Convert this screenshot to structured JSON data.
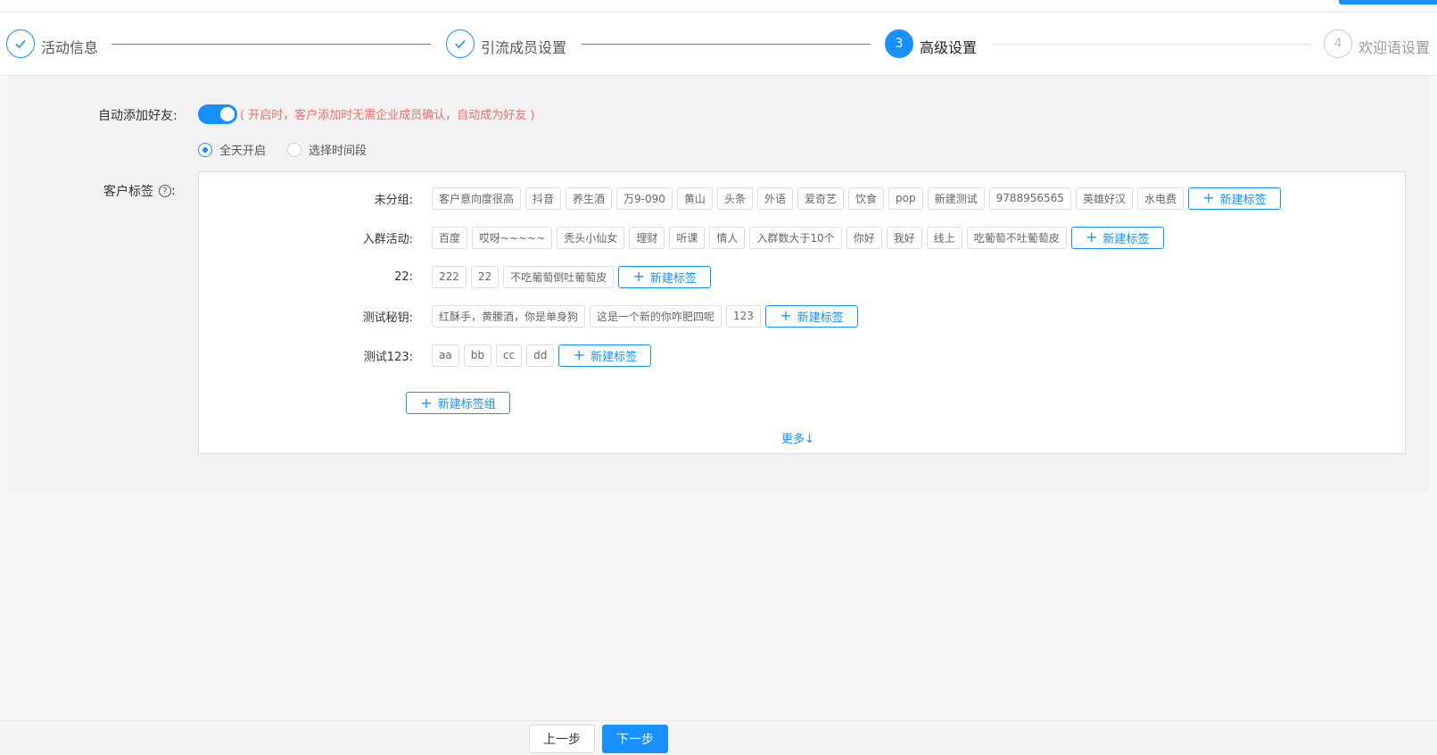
{
  "steps": [
    {
      "label": "活动信息",
      "status": "finish",
      "number": "1"
    },
    {
      "label": "引流成员设置",
      "status": "finish",
      "number": "2"
    },
    {
      "label": "高级设置",
      "status": "process",
      "number": "3"
    },
    {
      "label": "欢迎语设置",
      "status": "wait",
      "number": "4"
    }
  ],
  "form": {
    "auto_add_label": "自动添加好友:",
    "auto_add_enabled": true,
    "auto_add_hint": "( 开启时，客户添加时无需企业成员确认，自动成为好友 )",
    "radio_all_day": "全天开启",
    "radio_time_range": "选择时间段",
    "radio_selected": "全天开启",
    "customer_tags_label": "客户标签",
    "help_icon": "?"
  },
  "tag_groups": [
    {
      "name": "未分组:",
      "tags": [
        "客户意向度很高",
        "抖音",
        "养生酒",
        "万9-090",
        "黄山",
        "头条",
        "外语",
        "爱奇艺",
        "饮食",
        "pop",
        "新建测试",
        "9788956565",
        "英雄好汉",
        "水电费"
      ]
    },
    {
      "name": "入群活动:",
      "tags": [
        "百度",
        "哎呀~~~~~",
        "秃头小仙女",
        "理财",
        "听课",
        "情人",
        "入群数大于10个",
        "你好",
        "我好",
        "线上",
        "吃葡萄不吐葡萄皮"
      ]
    },
    {
      "name": "22:",
      "tags": [
        "222",
        "22",
        "不吃葡萄倒吐葡萄皮"
      ]
    },
    {
      "name": "测试秘钥:",
      "tags": [
        "红酥手，黄縢酒，你是单身狗",
        "这是一个新的你咋肥四呢",
        "123"
      ]
    },
    {
      "name": "测试123:",
      "tags": [
        "aa",
        "bb",
        "cc",
        "dd"
      ]
    }
  ],
  "new_tag_label": "新建标签",
  "new_group_label": "新建标签组",
  "more_label": "更多↓",
  "footer": {
    "prev_label": "上一步",
    "next_label": "下一步"
  },
  "colors": {
    "primary": "#1890ff",
    "hint": "#f56c6c"
  }
}
